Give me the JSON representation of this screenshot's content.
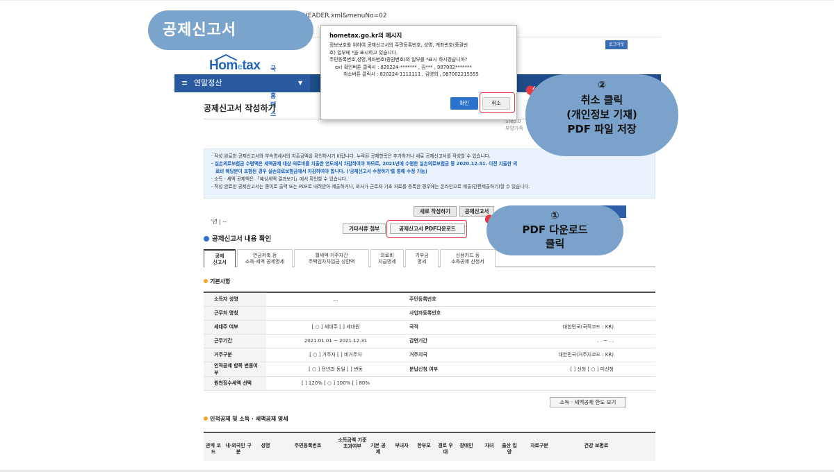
{
  "title_badge": "공제신고서",
  "browser": {
    "url_fragment": "HEADER.xml&menuNo=02"
  },
  "site": {
    "logo_text": "Hometax",
    "logo_sub": "국세청홈택스",
    "login_label": "로그아웃"
  },
  "nav": {
    "menu_label": "연말정산"
  },
  "page": {
    "heading": "공제신고서 작성하기",
    "step_text": "Step.0",
    "step_sub": "부양가족"
  },
  "notice": {
    "line1": "작성 완료한 공제신고서와 부속명세서의 지출금액을 확인하시기 바랍니다. 누락된 공제항목은 추가하거나 새로 공제신고서를 작성할 수 있습니다.",
    "line2": "실손의료보험금 수령액은 세액공제 대상 의료비를 지출한 연도에서 차감하여야 하므로, 2021년에 수령한 실손의료보험금 중 2020.12.31. 이전 지출한 의",
    "line3": "료비 해당분이 포함된 경우 실손의료보험금에서 차감하여야 합니다. ('공제신고서 수정하기'를 통해 수정 가능)",
    "line4": "소득 · 세액 공제액은 「예상세액 결과보기」에서 확인할 수 있습니다.",
    "line5": "작성 완료한 공제신고서는 종이로 출력 또는 PDF로 내려받아 제출하거나, 회사가 근로자 기초 자료를 등록한 경우에는 온라인으로 제출(간편제출하기)할 수 있습니다."
  },
  "toolbar": {
    "year_label": "'년 | --",
    "new_btn": "새로 작성하기",
    "modify_btn": "공제신고서",
    "attach_btn": "기타서류 첨부",
    "pdf_btn": "공제신고서 PDF다운로드",
    "blue_btn": "보기"
  },
  "section1": {
    "title": "공제신고서 내용 확인"
  },
  "tabs": [
    {
      "line1": "공제",
      "line2": "신고서"
    },
    {
      "line1": "연금저축 등",
      "line2": "소득·세액 공제명세"
    },
    {
      "line1": "월세액·거주자간",
      "line2": "주택임차차입금 상환액"
    },
    {
      "line1": "의료비",
      "line2": "지급명세"
    },
    {
      "line1": "기부금",
      "line2": "명세"
    },
    {
      "line1": "신용카드 등",
      "line2": "소득공제 신청서"
    }
  ],
  "basic": {
    "title": "기본사항",
    "rows": [
      {
        "label": "소득자 성명",
        "value": ",..",
        "label2": "주민등록번호",
        "value2": ""
      },
      {
        "label": "근무처 명칭",
        "value": "",
        "label2": "사업자등록번호",
        "value2": ""
      },
      {
        "label": "세대주 여부",
        "value": "[ ○ ] 세대주  [    ] 세대원",
        "label2": "국적",
        "value2": "대한민국(국적코드 : KR)"
      },
      {
        "label": "근무기간",
        "value": "2021.01.01 ~ 2021.12.31",
        "label2": "감면기간",
        "value2": ". . ~ . ."
      },
      {
        "label": "거주구분",
        "value": "[ ○ ] 거주자  [    ] 비거주자",
        "label2": "거주지국",
        "value2": "대한민국(거주지코드 : KR)"
      },
      {
        "label": "인적공제 항목 변동여부",
        "value": "[ ○ ] 전년과 동일  [    ] 변동",
        "label2": "분납신청 여부",
        "value2": "[    ] 신청  [ ○ ] 미신청"
      },
      {
        "label": "원천징수세액 선택",
        "value": "[    ] 120%  [ ○ ] 100%  [    ] 80%",
        "label2": "",
        "value2": ""
      }
    ],
    "limit_btn": "소득 · 세액공제 한도 보기"
  },
  "section2": {
    "title": "인적공제 및 소득 · 세액공제 명세"
  },
  "bottom_cols": [
    "관계 코드",
    "내·외국인 구분",
    "성명",
    "주민등록번호",
    "소득금액 기준 초과여부",
    "기본 공제",
    "부녀자",
    "한부모",
    "경로 우대",
    "장애인",
    "자녀",
    "출산 입양",
    "자료구분",
    "건강 보험료"
  ],
  "dialog": {
    "title": "hometax.go.kr의 메시지",
    "line1": "정보보호를 위하여 공제신고서의 주민등록번호, 성명, 계좌번호(증권번",
    "line2": "호) 일부에 *을 표시하고 있습니다.",
    "line3": "주민등록번호,성명,계좌번호(증권번호)의 일부를 *표시 하시겠습니까?",
    "line4": "ex) 확인버튼 클릭시 : 820224-*******  , 김***  , 087002*******",
    "line5": "취소버튼 클릭시 : 820224-1111111 , 김영희 , 087002215555",
    "ok": "확인",
    "cancel": "취소"
  },
  "callout2": {
    "num": "②",
    "l1": "취소 클릭",
    "l2": "(개인정보 기재)",
    "l3": "PDF 파일 저장"
  },
  "callout1": {
    "num": "①",
    "l1": "PDF 다운로드",
    "l2": "클릭"
  },
  "colors": {
    "callout": "#7ba4cd",
    "highlight": "#e53a44",
    "nav": "#1e4c8a"
  }
}
